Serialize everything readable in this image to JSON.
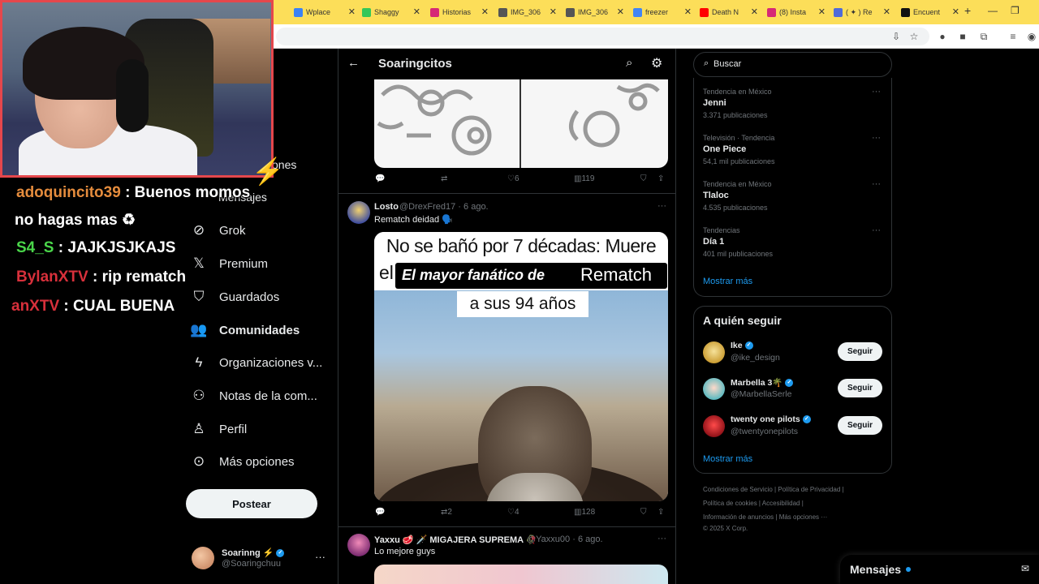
{
  "browser": {
    "tabs": [
      {
        "label": "",
        "color": "#ffffff"
      },
      {
        "label": "Wplace",
        "color": "#3b82f6"
      },
      {
        "label": "Shaggy",
        "color": "#34c759"
      },
      {
        "label": "Historias",
        "color": "#d62976"
      },
      {
        "label": "IMG_306",
        "color": "#555555"
      },
      {
        "label": "IMG_306",
        "color": "#555555"
      },
      {
        "label": "freezer",
        "color": "#4285f4"
      },
      {
        "label": "Death N",
        "color": "#ff0000"
      },
      {
        "label": "(8) Insta",
        "color": "#d62976"
      },
      {
        "label": "( ✦ ) Re",
        "color": "#4f6bd8"
      },
      {
        "label": "Encuent",
        "color": "#111111"
      }
    ]
  },
  "nav": {
    "items": [
      {
        "label": "Grok",
        "icon": "grok-icon"
      },
      {
        "label": "Premium",
        "icon": "x-logo-icon"
      },
      {
        "label": "Guardados",
        "icon": "bookmark-icon"
      },
      {
        "label": "Comunidades",
        "icon": "communities-icon"
      },
      {
        "label": "Organizaciones v...",
        "icon": "lightning-icon"
      },
      {
        "label": "Notas de la com...",
        "icon": "community-notes-icon"
      },
      {
        "label": "Perfil",
        "icon": "person-icon"
      },
      {
        "label": "Más opciones",
        "icon": "more-circle-icon"
      }
    ],
    "ghost_1": "ones",
    "ghost_2": "Mensajes",
    "post_label": "Postear",
    "account": {
      "name": "Soarinng ⚡",
      "handle": "@Soaringchuu",
      "more": "···"
    }
  },
  "feed": {
    "title": "Soaringcitos",
    "tweet0_actions": {
      "reply": "",
      "retweet": "",
      "likes": "6",
      "views": "119"
    },
    "tweet1": {
      "name": "Losto",
      "handle": "@DrexFred17",
      "date": "6 ago.",
      "text": "Rematch deidad 🗣️",
      "meme_line1": "No se bañó por 7 décadas: Muere",
      "meme_el": "el",
      "meme_overlay_a": "El mayor fanático de",
      "meme_overlay_b": "Rematch",
      "meme_line3": "a sus 94 años",
      "retweets": "2",
      "likes": "4",
      "views": "128"
    },
    "tweet2": {
      "name": "Yaxxu 🥩 🗡️ MIGAJERA SUPREMA 🥀",
      "handle": "@Yaxxu00",
      "date": "6 ago.",
      "text": "Lo mejore guys"
    }
  },
  "right": {
    "search_placeholder": "Buscar",
    "trends": [
      {
        "context": "Tendencia en México",
        "title": "Jenni",
        "count": "3.371 publicaciones"
      },
      {
        "context": "Televisión · Tendencia",
        "title": "One Piece",
        "count": "54,1 mil publicaciones"
      },
      {
        "context": "Tendencia en México",
        "title": "Tlaloc",
        "count": "4.535 publicaciones"
      },
      {
        "context": "Tendencias",
        "title": "Día 1",
        "count": "401 mil publicaciones"
      }
    ],
    "trends_more": "Mostrar más",
    "who_to_follow_title": "A quién seguir",
    "who_to_follow": [
      {
        "name": "Ike",
        "handle": "@ike_design",
        "button": "Seguir",
        "color": "#e3b341"
      },
      {
        "name": "Marbella 3🌴",
        "handle": "@MarbellaSerle",
        "button": "Seguir",
        "color": "#7fd1c6"
      },
      {
        "name": "twenty one pilots",
        "handle": "@twentyonepilots",
        "button": "Seguir",
        "color": "#c41e2a"
      }
    ],
    "wtf_more": "Mostrar más",
    "footer": [
      "Condiciones de Servicio  |  Política de Privacidad  |",
      "Política de cookies  |  Accesibilidad  |",
      "Información de anuncios  |  Más opciones ···",
      "© 2025 X Corp."
    ],
    "messages_label": "Mensajes"
  },
  "stream": {
    "chat": [
      {
        "user": "adoquincito39",
        "msg": ": Buenos momos"
      },
      {
        "user": "",
        "msg": "no hagas mas ♻"
      },
      {
        "user": "S4_S",
        "msg": ": JAJKJSJKAJS"
      },
      {
        "user": "BylanXTV",
        "msg": ": rip rematch"
      },
      {
        "user": "anXTV",
        "msg": ": CUAL BUENA"
      }
    ]
  }
}
